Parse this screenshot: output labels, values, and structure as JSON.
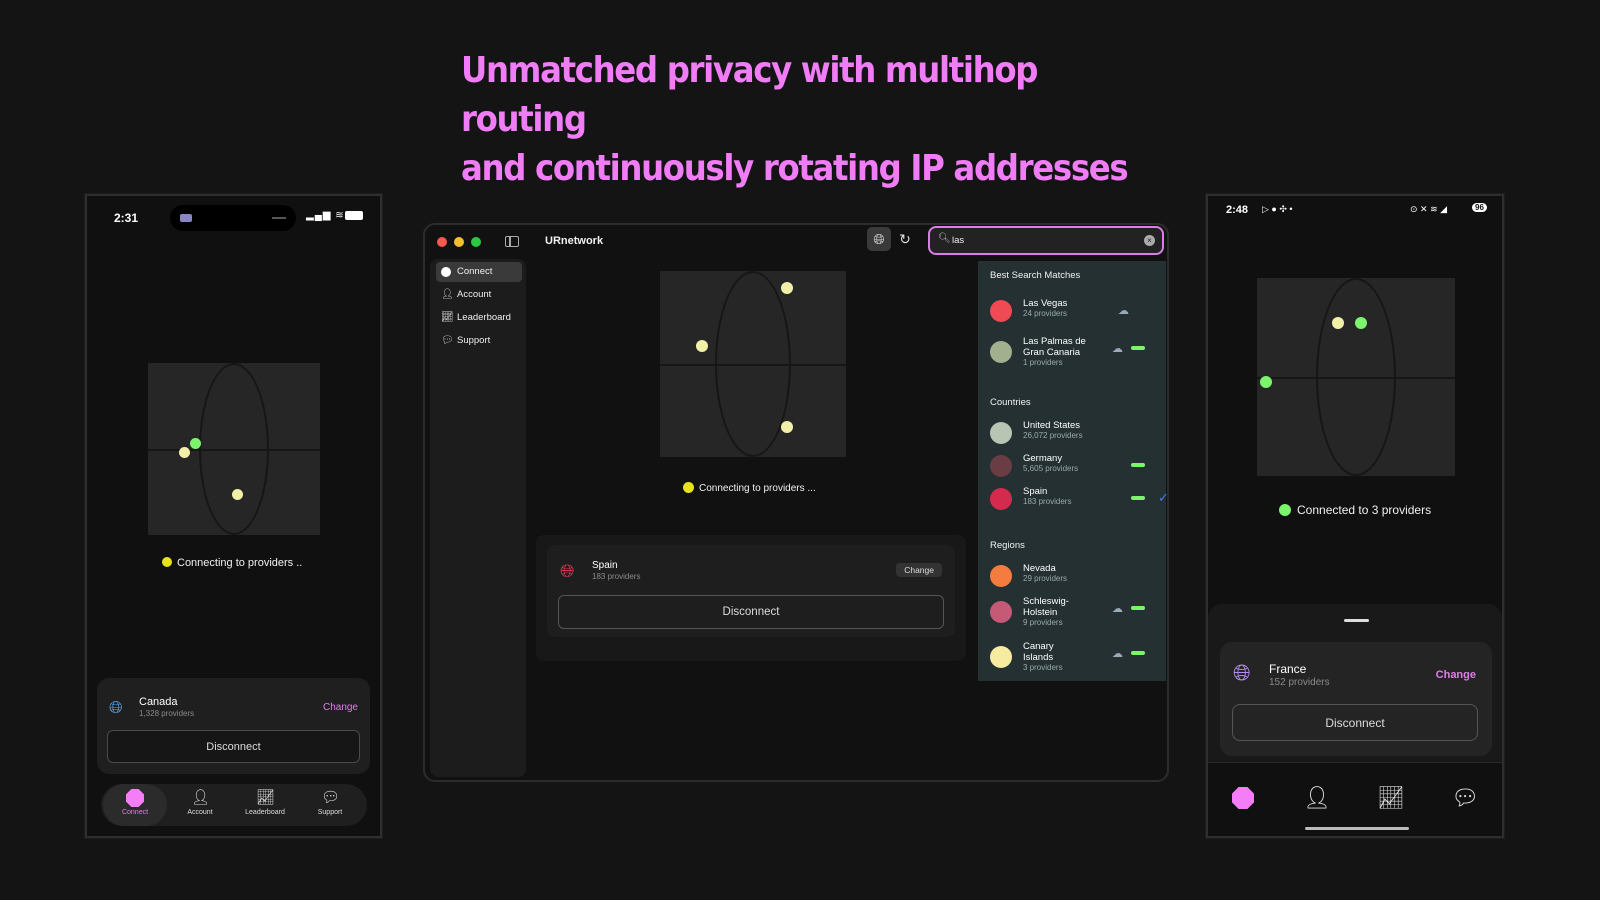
{
  "headline": {
    "line1": "Unmatched privacy with multihop routing",
    "line2": "and continuously rotating IP addresses"
  },
  "colors": {
    "accent": "#f07cf6",
    "connecting": "#e8e21e",
    "connected": "#7cf56c",
    "background": "#141414"
  },
  "left_phone": {
    "time": "2:31",
    "status": "Connecting to providers  ..",
    "location": {
      "name": "Canada",
      "providers": "1,328 providers",
      "change_label": "Change",
      "icon": "globe-icon"
    },
    "disconnect_label": "Disconnect",
    "nav": [
      {
        "label": "Connect",
        "icon": "connect-octagon-icon"
      },
      {
        "label": "Account",
        "icon": "person-icon"
      },
      {
        "label": "Leaderboard",
        "icon": "chart-icon"
      },
      {
        "label": "Support",
        "icon": "chat-icon"
      }
    ]
  },
  "desktop": {
    "app_title": "URnetwork",
    "sidebar": [
      {
        "label": "Connect",
        "icon": "connect-dot-icon"
      },
      {
        "label": "Account",
        "icon": "person-icon"
      },
      {
        "label": "Leaderboard",
        "icon": "chart-icon"
      },
      {
        "label": "Support",
        "icon": "chat-icon"
      }
    ],
    "search": {
      "value": "las",
      "placeholder": ""
    },
    "status": "Connecting to providers  ...",
    "location": {
      "name": "Spain",
      "providers": "183 providers",
      "change_label": "Change",
      "icon": "globe-icon"
    },
    "disconnect_label": "Disconnect",
    "results": {
      "best_title": "Best Search Matches",
      "best": [
        {
          "name": "Las Vegas",
          "providers": "24 providers",
          "color": "#f04a55"
        },
        {
          "name": "Las Palmas de Gran Canaria",
          "providers": "1 providers",
          "color": "#a3b08f"
        }
      ],
      "countries_title": "Countries",
      "countries": [
        {
          "name": "United States",
          "providers": "26,072 providers",
          "color": "#b8c4b4"
        },
        {
          "name": "Germany",
          "providers": "5,605 providers",
          "color": "#6a3c44"
        },
        {
          "name": "Spain",
          "providers": "183 providers",
          "color": "#d42a4e"
        }
      ],
      "regions_title": "Regions",
      "regions": [
        {
          "name": "Nevada",
          "providers": "29 providers",
          "color": "#f37c3e"
        },
        {
          "name": "Schleswig-Holstein",
          "providers": "9 providers",
          "color": "#c45a76"
        },
        {
          "name": "Canary Islands",
          "providers": "3 providers",
          "color": "#f6eba0"
        }
      ]
    }
  },
  "right_phone": {
    "time": "2:48",
    "battery": "96",
    "status": "Connected to 3 providers",
    "location": {
      "name": "France",
      "providers": "152 providers",
      "change_label": "Change",
      "icon": "globe-icon"
    },
    "disconnect_label": "Disconnect"
  }
}
